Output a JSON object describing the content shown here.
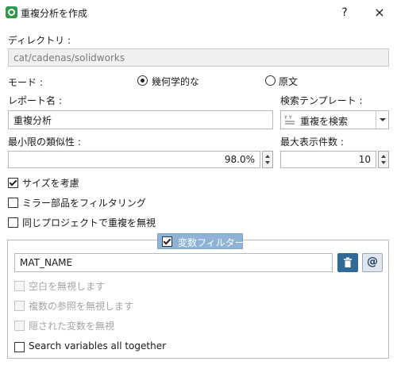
{
  "window": {
    "title": "重複分析を作成",
    "help": "?",
    "close": "×",
    "icon": "app-icon"
  },
  "directory": {
    "label": "ディレクトリ :",
    "value": "cat/cadenas/solidworks"
  },
  "mode": {
    "label": "モード :",
    "options": [
      {
        "label": "幾何学的な",
        "selected": true
      },
      {
        "label": "原文",
        "selected": false
      }
    ]
  },
  "report": {
    "label": "レポート名 :",
    "value": "重複分析"
  },
  "template": {
    "label": "検索テンプレート :",
    "selected": "重複を検索",
    "icon": "template-icon"
  },
  "similarity": {
    "label": "最小限の類似性 :",
    "value": "98.0%"
  },
  "max_results": {
    "label": "最大表示件数 :",
    "value": "10"
  },
  "checks": [
    {
      "label": "サイズを考慮",
      "checked": true
    },
    {
      "label": "ミラー部品をフィルタリング",
      "checked": false
    },
    {
      "label": "同じプロジェクトで重複を無視",
      "checked": false
    }
  ],
  "variable_filter": {
    "title": "変数フィルター",
    "enabled": true,
    "input_value": "MAT_NAME",
    "delete_icon": "trash-icon",
    "at_label": "@",
    "options": [
      {
        "label": "空白を無視します",
        "checked": false,
        "enabled": false
      },
      {
        "label": "複数の参照を無視します",
        "checked": false,
        "enabled": false
      },
      {
        "label": "隠された変数を無視",
        "checked": false,
        "enabled": false
      },
      {
        "label": "Search variables all together",
        "checked": false,
        "enabled": true
      }
    ]
  },
  "colors": {
    "accent": "#2e9a4a",
    "group_header": "#8fb3d6",
    "trash_button": "#2f6a98"
  }
}
